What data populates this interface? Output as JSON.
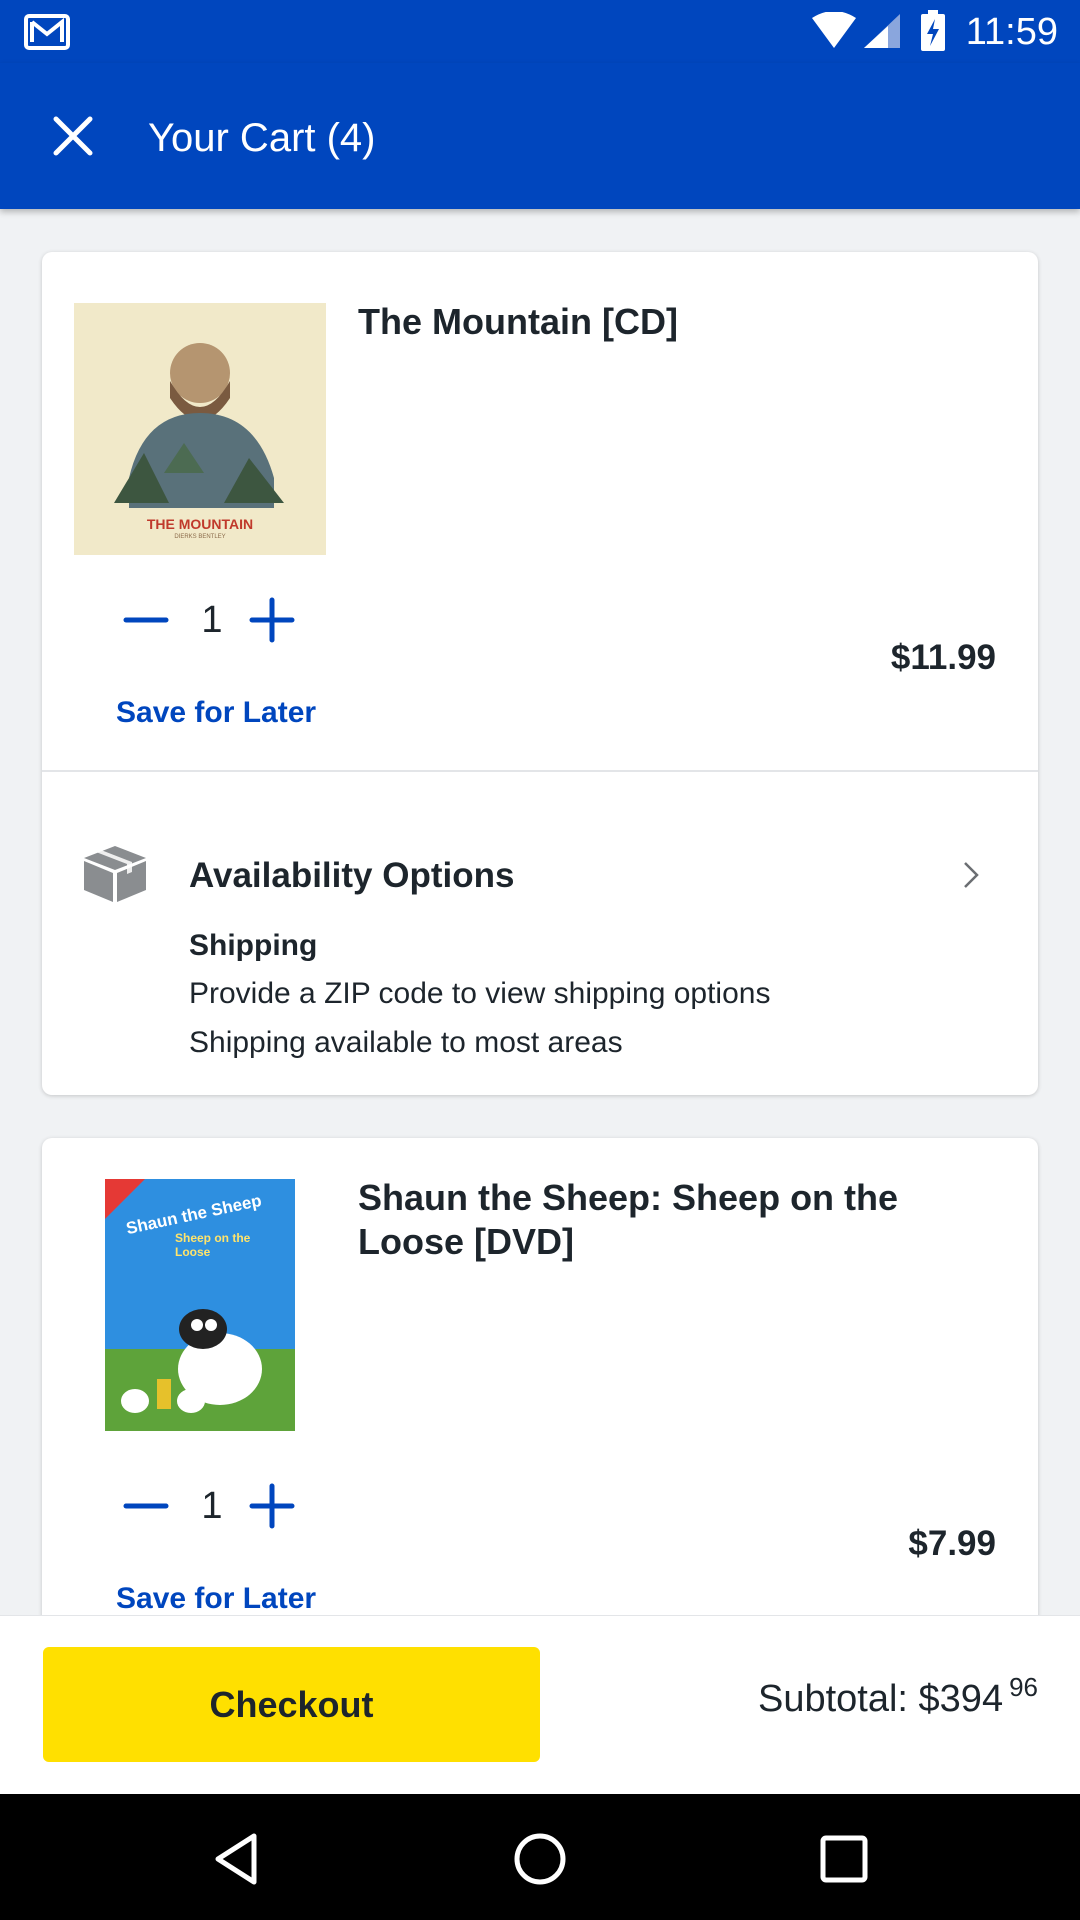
{
  "status_bar": {
    "time": "11:59",
    "icons": [
      "gmail-icon",
      "wifi-icon",
      "signal-icon",
      "battery-charging-icon"
    ]
  },
  "header": {
    "title": "Your Cart (4)",
    "close_icon": "close-icon"
  },
  "cart_items": [
    {
      "name": "The Mountain [CD]",
      "quantity": "1",
      "save_label": "Save for Later",
      "price": "$11.99",
      "cover_text": "THE MOUNTAIN",
      "cover_subtext": "DIERKS BENTLEY"
    },
    {
      "name": "Shaun the Sheep: Sheep on the Loose [DVD]",
      "quantity": "1",
      "save_label": "Save for Later",
      "price": "$7.99",
      "cover_text": "Shaun the Sheep",
      "cover_subtext": "Sheep on the Loose"
    }
  ],
  "availability": {
    "title": "Availability Options",
    "shipping_title": "Shipping",
    "shipping_line1": "Provide a ZIP code to view shipping options",
    "shipping_line2": "Shipping available to most areas"
  },
  "footer": {
    "checkout_label": "Checkout",
    "subtotal_label": "Subtotal: $394",
    "subtotal_cents": "96"
  },
  "nav": [
    "back-icon",
    "home-icon",
    "recents-icon"
  ],
  "colors": {
    "brand_blue": "#0046be",
    "checkout_yellow": "#ffe000",
    "text_dark": "#1d252c"
  }
}
